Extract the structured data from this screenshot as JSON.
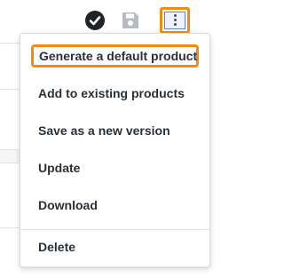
{
  "toolbar": {
    "icons": [
      "check-circle-icon",
      "floppy-disk-icon",
      "vertical-ellipsis-icon"
    ]
  },
  "menu": {
    "items": [
      {
        "label": "Generate a default product"
      },
      {
        "label": "Add to existing products"
      },
      {
        "label": "Save as a new version"
      },
      {
        "label": "Update"
      },
      {
        "label": "Download"
      },
      {
        "label": "Delete"
      }
    ]
  },
  "colors": {
    "highlight": "#f28c0f",
    "text": "#2a3038",
    "icon_dark": "#1f2328",
    "icon_disabled": "#b8bcc2",
    "focus_blue": "#5b7fd3"
  }
}
